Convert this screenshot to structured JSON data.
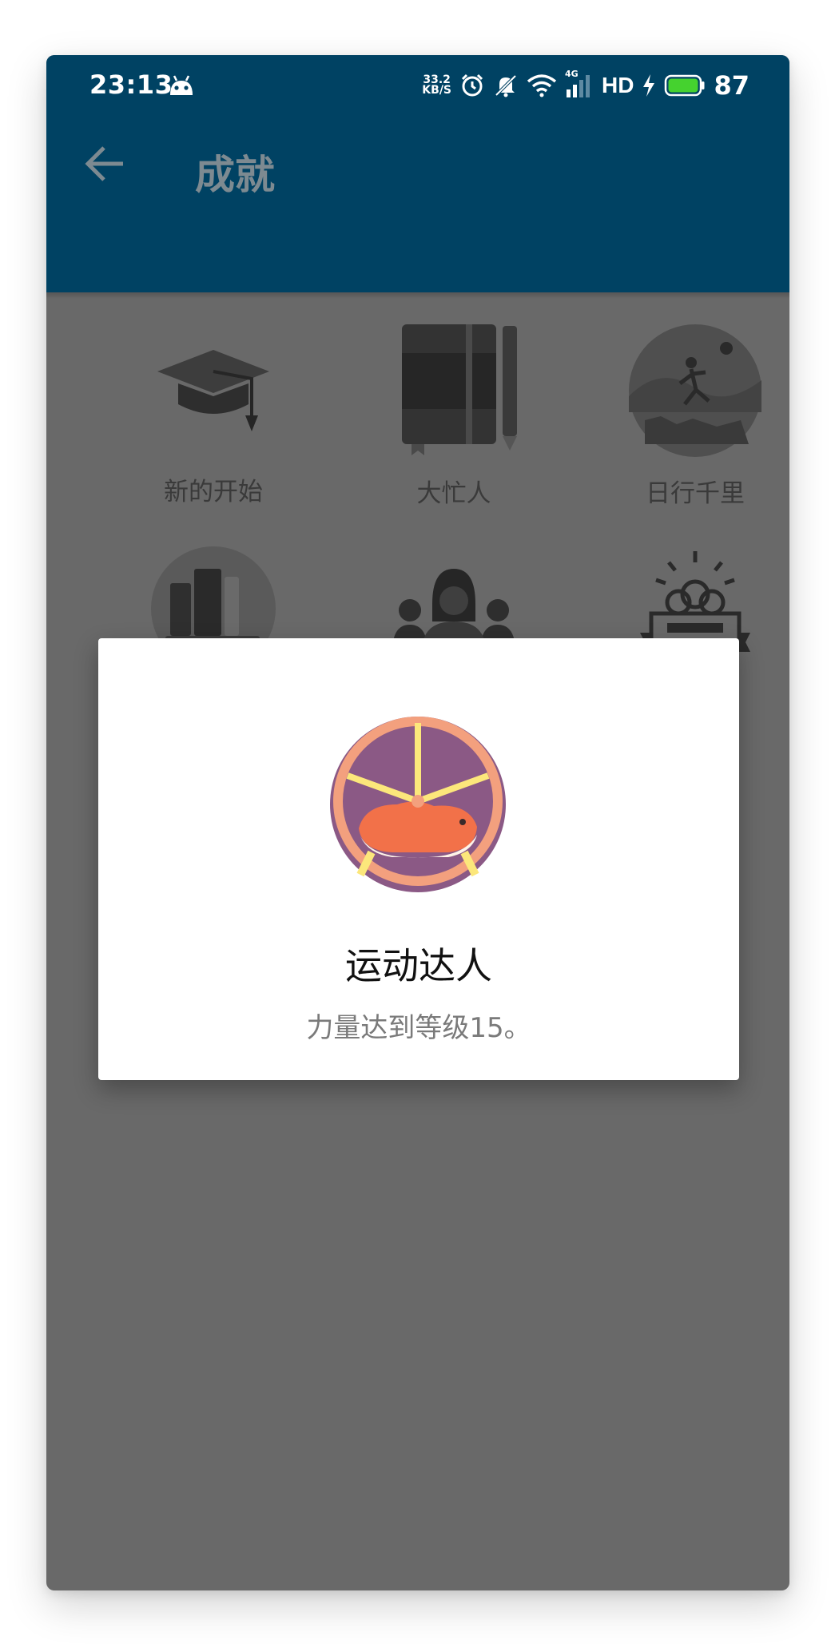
{
  "status_bar": {
    "time": "23:13",
    "net_speed_value": "33.2",
    "net_speed_unit": "KB/S",
    "network_type": "4G",
    "hd_label": "HD",
    "battery_level": "87",
    "icons": [
      "android-icon",
      "alarm-icon",
      "mute-icon",
      "wifi-icon",
      "signal-icon",
      "charging-icon",
      "battery-icon"
    ]
  },
  "toolbar": {
    "title": "成就",
    "back_icon": "arrow-left-icon"
  },
  "achievements": [
    {
      "label": "新的开始",
      "icon": "graduation-cap-icon"
    },
    {
      "label": "大忙人",
      "icon": "notebook-pencil-icon"
    },
    {
      "label": "日行千里",
      "icon": "runner-icon"
    },
    {
      "label": "",
      "icon": "books-icon"
    },
    {
      "label": "",
      "icon": "people-icon"
    },
    {
      "label": "",
      "icon": "award-icon"
    }
  ],
  "dialog": {
    "title": "运动达人",
    "description": "力量达到等级15。",
    "icon": "hamster-wheel-icon"
  },
  "colors": {
    "app_bar": "#004263",
    "overlay": "#696969",
    "dialog_bg": "#ffffff"
  }
}
